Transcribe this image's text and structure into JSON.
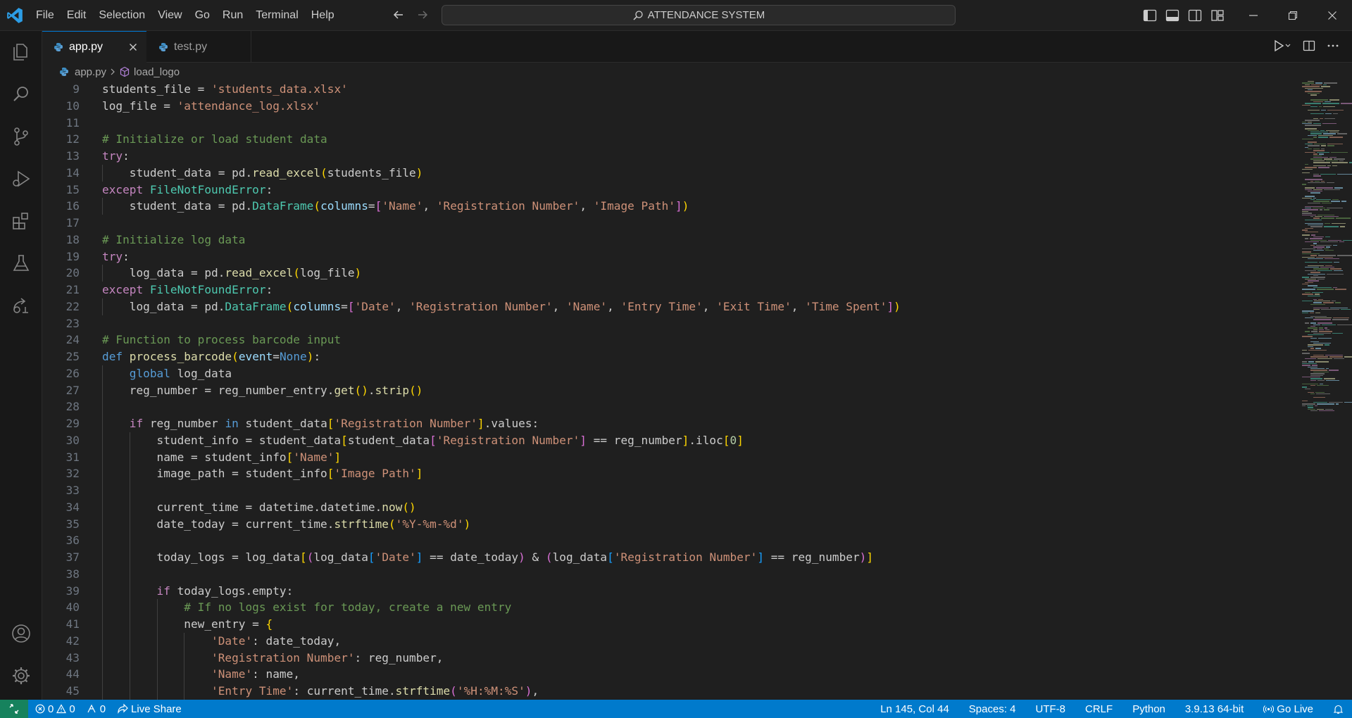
{
  "titlebar": {
    "menu": [
      "File",
      "Edit",
      "Selection",
      "View",
      "Go",
      "Run",
      "Terminal",
      "Help"
    ],
    "search_text": "ATTENDANCE SYSTEM"
  },
  "tabs": [
    {
      "label": "app.py",
      "active": true
    },
    {
      "label": "test.py",
      "active": false
    }
  ],
  "breadcrumb": {
    "file": "app.py",
    "symbol": "load_logo"
  },
  "code_lines": [
    {
      "n": "9",
      "indent": 0,
      "tokens": [
        [
          "plain",
          "students_file = "
        ],
        [
          "str",
          "'students_data.xlsx'"
        ]
      ]
    },
    {
      "n": "10",
      "indent": 0,
      "tokens": [
        [
          "plain",
          "log_file = "
        ],
        [
          "str",
          "'attendance_log.xlsx'"
        ]
      ]
    },
    {
      "n": "11",
      "indent": 0,
      "tokens": []
    },
    {
      "n": "12",
      "indent": 0,
      "tokens": [
        [
          "cm",
          "# Initialize or load student data"
        ]
      ]
    },
    {
      "n": "13",
      "indent": 0,
      "tokens": [
        [
          "kw",
          "try"
        ],
        [
          "plain",
          ":"
        ]
      ]
    },
    {
      "n": "14",
      "indent": 1,
      "tokens": [
        [
          "plain",
          "    student_data = pd."
        ],
        [
          "fn",
          "read_excel"
        ],
        [
          "b1",
          "("
        ],
        [
          "plain",
          "students_file"
        ],
        [
          "b1",
          ")"
        ]
      ]
    },
    {
      "n": "15",
      "indent": 0,
      "tokens": [
        [
          "kw",
          "except"
        ],
        [
          "plain",
          " "
        ],
        [
          "cls",
          "FileNotFoundError"
        ],
        [
          "plain",
          ":"
        ]
      ]
    },
    {
      "n": "16",
      "indent": 1,
      "tokens": [
        [
          "plain",
          "    student_data = pd."
        ],
        [
          "cls",
          "DataFrame"
        ],
        [
          "b1",
          "("
        ],
        [
          "var",
          "columns"
        ],
        [
          "plain",
          "="
        ],
        [
          "b2",
          "["
        ],
        [
          "str",
          "'Name'"
        ],
        [
          "plain",
          ", "
        ],
        [
          "str",
          "'Registration Number'"
        ],
        [
          "plain",
          ", "
        ],
        [
          "str",
          "'Image Path'"
        ],
        [
          "b2",
          "]"
        ],
        [
          "b1",
          ")"
        ]
      ]
    },
    {
      "n": "17",
      "indent": 0,
      "tokens": []
    },
    {
      "n": "18",
      "indent": 0,
      "tokens": [
        [
          "cm",
          "# Initialize log data"
        ]
      ]
    },
    {
      "n": "19",
      "indent": 0,
      "tokens": [
        [
          "kw",
          "try"
        ],
        [
          "plain",
          ":"
        ]
      ]
    },
    {
      "n": "20",
      "indent": 1,
      "tokens": [
        [
          "plain",
          "    log_data = pd."
        ],
        [
          "fn",
          "read_excel"
        ],
        [
          "b1",
          "("
        ],
        [
          "plain",
          "log_file"
        ],
        [
          "b1",
          ")"
        ]
      ]
    },
    {
      "n": "21",
      "indent": 0,
      "tokens": [
        [
          "kw",
          "except"
        ],
        [
          "plain",
          " "
        ],
        [
          "cls",
          "FileNotFoundError"
        ],
        [
          "plain",
          ":"
        ]
      ]
    },
    {
      "n": "22",
      "indent": 1,
      "tokens": [
        [
          "plain",
          "    log_data = pd."
        ],
        [
          "cls",
          "DataFrame"
        ],
        [
          "b1",
          "("
        ],
        [
          "var",
          "columns"
        ],
        [
          "plain",
          "="
        ],
        [
          "b2",
          "["
        ],
        [
          "str",
          "'Date'"
        ],
        [
          "plain",
          ", "
        ],
        [
          "str",
          "'Registration Number'"
        ],
        [
          "plain",
          ", "
        ],
        [
          "str",
          "'Name'"
        ],
        [
          "plain",
          ", "
        ],
        [
          "str",
          "'Entry Time'"
        ],
        [
          "plain",
          ", "
        ],
        [
          "str",
          "'Exit Time'"
        ],
        [
          "plain",
          ", "
        ],
        [
          "str",
          "'Time Spent'"
        ],
        [
          "b2",
          "]"
        ],
        [
          "b1",
          ")"
        ]
      ]
    },
    {
      "n": "23",
      "indent": 0,
      "tokens": []
    },
    {
      "n": "24",
      "indent": 0,
      "tokens": [
        [
          "cm",
          "# Function to process barcode input"
        ]
      ]
    },
    {
      "n": "25",
      "indent": 0,
      "tokens": [
        [
          "dk",
          "def"
        ],
        [
          "plain",
          " "
        ],
        [
          "fn",
          "process_barcode"
        ],
        [
          "b1",
          "("
        ],
        [
          "var",
          "event"
        ],
        [
          "plain",
          "="
        ],
        [
          "dk",
          "None"
        ],
        [
          "b1",
          ")"
        ],
        [
          "plain",
          ":"
        ]
      ]
    },
    {
      "n": "26",
      "indent": 1,
      "tokens": [
        [
          "plain",
          "    "
        ],
        [
          "dk",
          "global"
        ],
        [
          "plain",
          " log_data"
        ]
      ]
    },
    {
      "n": "27",
      "indent": 1,
      "tokens": [
        [
          "plain",
          "    reg_number = reg_number_entry."
        ],
        [
          "fn",
          "get"
        ],
        [
          "b1",
          "()"
        ],
        [
          "plain",
          "."
        ],
        [
          "fn",
          "strip"
        ],
        [
          "b1",
          "()"
        ]
      ]
    },
    {
      "n": "28",
      "indent": 1,
      "tokens": []
    },
    {
      "n": "29",
      "indent": 1,
      "tokens": [
        [
          "plain",
          "    "
        ],
        [
          "kw",
          "if"
        ],
        [
          "plain",
          " reg_number "
        ],
        [
          "dk",
          "in"
        ],
        [
          "plain",
          " student_data"
        ],
        [
          "b1",
          "["
        ],
        [
          "str",
          "'Registration Number'"
        ],
        [
          "b1",
          "]"
        ],
        [
          "plain",
          ".values:"
        ]
      ]
    },
    {
      "n": "30",
      "indent": 2,
      "tokens": [
        [
          "plain",
          "        student_info = student_data"
        ],
        [
          "b1",
          "["
        ],
        [
          "plain",
          "student_data"
        ],
        [
          "b2",
          "["
        ],
        [
          "str",
          "'Registration Number'"
        ],
        [
          "b2",
          "]"
        ],
        [
          "plain",
          " == reg_number"
        ],
        [
          "b1",
          "]"
        ],
        [
          "plain",
          ".iloc"
        ],
        [
          "b1",
          "["
        ],
        [
          "num",
          "0"
        ],
        [
          "b1",
          "]"
        ]
      ]
    },
    {
      "n": "31",
      "indent": 2,
      "tokens": [
        [
          "plain",
          "        name = student_info"
        ],
        [
          "b1",
          "["
        ],
        [
          "str",
          "'Name'"
        ],
        [
          "b1",
          "]"
        ]
      ]
    },
    {
      "n": "32",
      "indent": 2,
      "tokens": [
        [
          "plain",
          "        image_path = student_info"
        ],
        [
          "b1",
          "["
        ],
        [
          "str",
          "'Image Path'"
        ],
        [
          "b1",
          "]"
        ]
      ]
    },
    {
      "n": "33",
      "indent": 2,
      "tokens": []
    },
    {
      "n": "34",
      "indent": 2,
      "tokens": [
        [
          "plain",
          "        current_time = datetime.datetime."
        ],
        [
          "fn",
          "now"
        ],
        [
          "b1",
          "()"
        ]
      ]
    },
    {
      "n": "35",
      "indent": 2,
      "tokens": [
        [
          "plain",
          "        date_today = current_time."
        ],
        [
          "fn",
          "strftime"
        ],
        [
          "b1",
          "("
        ],
        [
          "str",
          "'%Y-%m-%d'"
        ],
        [
          "b1",
          ")"
        ]
      ]
    },
    {
      "n": "36",
      "indent": 2,
      "tokens": []
    },
    {
      "n": "37",
      "indent": 2,
      "tokens": [
        [
          "plain",
          "        today_logs = log_data"
        ],
        [
          "b1",
          "["
        ],
        [
          "b2",
          "("
        ],
        [
          "plain",
          "log_data"
        ],
        [
          "b3",
          "["
        ],
        [
          "str",
          "'Date'"
        ],
        [
          "b3",
          "]"
        ],
        [
          "plain",
          " == date_today"
        ],
        [
          "b2",
          ")"
        ],
        [
          "plain",
          " & "
        ],
        [
          "b2",
          "("
        ],
        [
          "plain",
          "log_data"
        ],
        [
          "b3",
          "["
        ],
        [
          "str",
          "'Registration Number'"
        ],
        [
          "b3",
          "]"
        ],
        [
          "plain",
          " == reg_number"
        ],
        [
          "b2",
          ")"
        ],
        [
          "b1",
          "]"
        ]
      ]
    },
    {
      "n": "38",
      "indent": 2,
      "tokens": []
    },
    {
      "n": "39",
      "indent": 2,
      "tokens": [
        [
          "plain",
          "        "
        ],
        [
          "kw",
          "if"
        ],
        [
          "plain",
          " today_logs.empty:"
        ]
      ]
    },
    {
      "n": "40",
      "indent": 3,
      "tokens": [
        [
          "plain",
          "            "
        ],
        [
          "cm",
          "# If no logs exist for today, create a new entry"
        ]
      ]
    },
    {
      "n": "41",
      "indent": 3,
      "tokens": [
        [
          "plain",
          "            new_entry = "
        ],
        [
          "b1",
          "{"
        ]
      ]
    },
    {
      "n": "42",
      "indent": 4,
      "tokens": [
        [
          "plain",
          "                "
        ],
        [
          "str",
          "'Date'"
        ],
        [
          "plain",
          ": date_today,"
        ]
      ]
    },
    {
      "n": "43",
      "indent": 4,
      "tokens": [
        [
          "plain",
          "                "
        ],
        [
          "str",
          "'Registration Number'"
        ],
        [
          "plain",
          ": reg_number,"
        ]
      ]
    },
    {
      "n": "44",
      "indent": 4,
      "tokens": [
        [
          "plain",
          "                "
        ],
        [
          "str",
          "'Name'"
        ],
        [
          "plain",
          ": name,"
        ]
      ]
    },
    {
      "n": "45",
      "indent": 4,
      "tokens": [
        [
          "plain",
          "                "
        ],
        [
          "str",
          "'Entry Time'"
        ],
        [
          "plain",
          ": current_time."
        ],
        [
          "fn",
          "strftime"
        ],
        [
          "b2",
          "("
        ],
        [
          "str",
          "'%H:%M:%S'"
        ],
        [
          "b2",
          ")"
        ],
        [
          "plain",
          ","
        ]
      ]
    }
  ],
  "statusbar": {
    "errors": "0",
    "warnings": "0",
    "ports": "0",
    "live_share": "Live Share",
    "cursor": "Ln 145, Col 44",
    "spaces": "Spaces: 4",
    "encoding": "UTF-8",
    "eol": "CRLF",
    "language": "Python",
    "interpreter": "3.9.13 64-bit",
    "go_live": "Go Live"
  },
  "colors": {
    "accent": "#007acc",
    "remote": "#16825d",
    "editor_bg": "#1f1f1f"
  },
  "icons": {
    "activity": [
      "explorer-icon",
      "search-icon",
      "source-control-icon",
      "run-debug-icon",
      "extensions-icon",
      "testing-icon",
      "remote-explorer-icon",
      "accounts-icon",
      "manage-gear-icon"
    ]
  }
}
